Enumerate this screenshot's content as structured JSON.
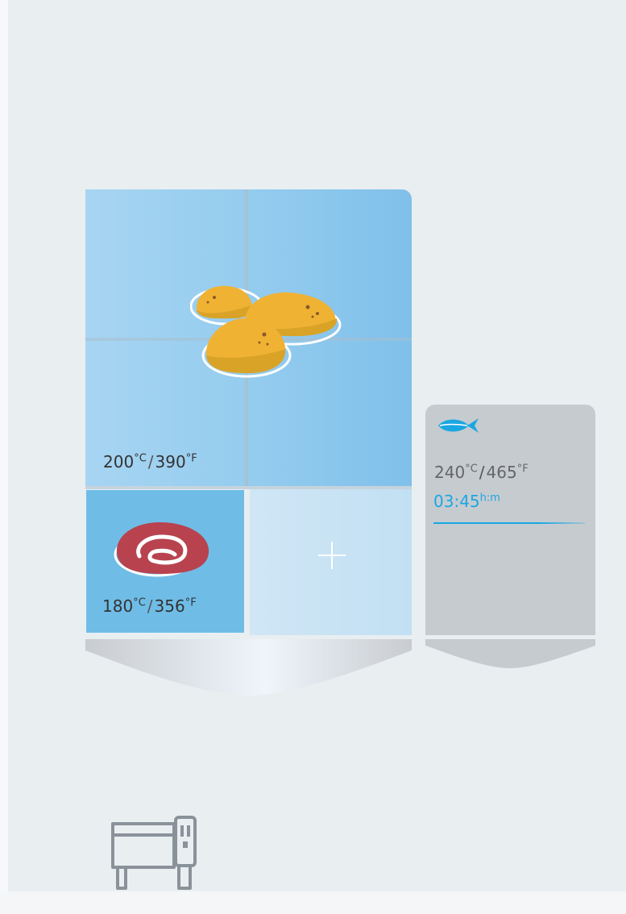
{
  "colors": {
    "background": "#e9eef1",
    "active_tile": "#6fbde6",
    "side_panel": "#c6cbd0",
    "timer_accent": "#1ba7e2"
  },
  "main_cavity": {
    "top_zone": {
      "food_icon": "nuggets-icon",
      "temp_c": "200",
      "temp_c_unit": "°C",
      "temp_f": "390",
      "temp_f_unit": "°F"
    },
    "bottom_left_zone": {
      "food_icon": "meat-icon",
      "temp_c": "180",
      "temp_c_unit": "°C",
      "temp_f": "356",
      "temp_f_unit": "°F"
    },
    "bottom_right_zone": {
      "icon": "plus-icon"
    }
  },
  "side_cavity": {
    "food_icon": "fish-icon",
    "temp_c": "240",
    "temp_c_unit": "°C",
    "temp_f": "465",
    "temp_f_unit": "°F",
    "timer": "03:45",
    "timer_unit": "h:m"
  },
  "footer": {
    "icon": "oven-icon"
  }
}
